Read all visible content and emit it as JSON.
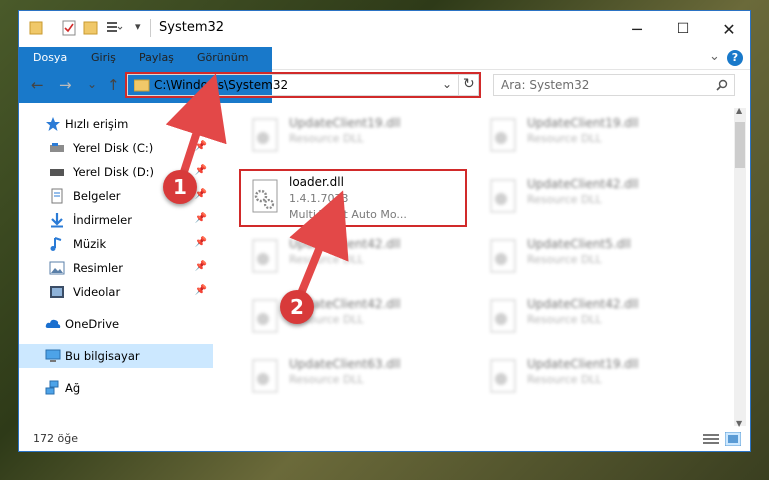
{
  "window": {
    "title": "System32"
  },
  "controls": {
    "minimize": "─",
    "maximize": "☐",
    "close": "✕"
  },
  "ribbon": {
    "tabs": [
      "Dosya",
      "Giriş",
      "Paylaş",
      "Görünüm"
    ],
    "expand": "⌄",
    "help": "?"
  },
  "nav": {
    "back": "←",
    "forward": "→",
    "recent": "⌄",
    "up": "↑",
    "refresh": "↻",
    "dropdown": "⌄"
  },
  "address": {
    "path": "C:\\Windows\\System32"
  },
  "search": {
    "placeholder": "Ara: System32",
    "icon": "search-icon"
  },
  "sidebar": {
    "items": [
      {
        "label": "Hızlı erişim",
        "icon": "star-icon",
        "pinned": false
      },
      {
        "label": "Yerel Disk (C:)",
        "icon": "drive-icon",
        "pinned": true
      },
      {
        "label": "Yerel Disk (D:)",
        "icon": "drive-icon",
        "pinned": true
      },
      {
        "label": "Belgeler",
        "icon": "documents-icon",
        "pinned": true
      },
      {
        "label": "İndirmeler",
        "icon": "download-icon",
        "pinned": true
      },
      {
        "label": "Müzik",
        "icon": "music-icon",
        "pinned": true
      },
      {
        "label": "Resimler",
        "icon": "pictures-icon",
        "pinned": true
      },
      {
        "label": "Videolar",
        "icon": "videos-icon",
        "pinned": true
      },
      {
        "label": "OneDrive",
        "icon": "cloud-icon",
        "pinned": false
      },
      {
        "label": "Bu bilgisayar",
        "icon": "computer-icon",
        "pinned": false,
        "selected": true
      },
      {
        "label": "Ağ",
        "icon": "network-icon",
        "pinned": false
      }
    ]
  },
  "files": [
    {
      "name": "UpdateClient19.dll",
      "desc": "Resource DLL"
    },
    {
      "name": "UpdateClient19.dll",
      "desc": "Resource DLL"
    },
    {
      "name": "loader.dll",
      "version": "1.4.1.7073",
      "desc": "Multi Theft Auto Mo...",
      "highlighted": true
    },
    {
      "name": "UpdateClient42.dll",
      "desc": "Resource DLL"
    },
    {
      "name": "UpdateClient42.dll",
      "desc": "Resource DLL"
    },
    {
      "name": "UpdateClient5.dll",
      "desc": "Resource DLL"
    },
    {
      "name": "UpdateClient42.dll",
      "desc": "Resource DLL"
    },
    {
      "name": "UpdateClient42.dll",
      "desc": "Resource DLL"
    },
    {
      "name": "UpdateClient63.dll",
      "desc": "Resource DLL"
    },
    {
      "name": "UpdateClient19.dll",
      "desc": "Resource DLL"
    }
  ],
  "status": {
    "count": "172 öğe"
  },
  "annotations": [
    {
      "label": "1"
    },
    {
      "label": "2"
    }
  ],
  "colors": {
    "accent": "#1979ca",
    "highlight": "#d12a2a",
    "selected": "#cce8ff"
  }
}
